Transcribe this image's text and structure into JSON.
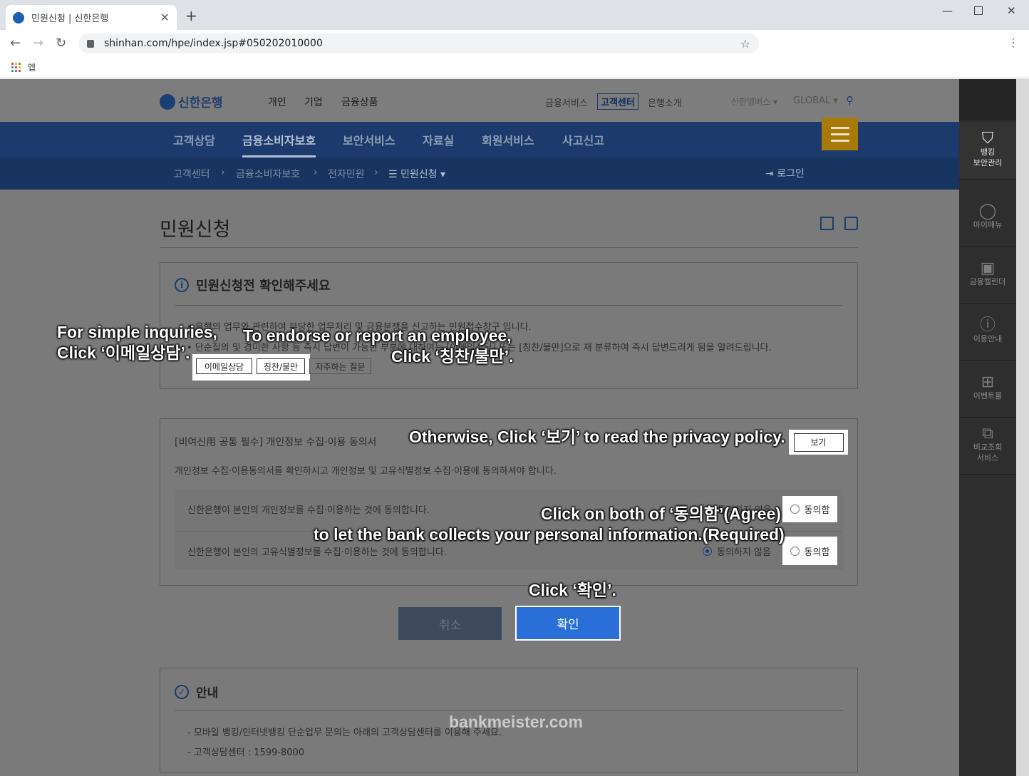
{
  "browser": {
    "tab_title": "민원신청 | 신한은행",
    "url": "shinhan.com/hpe/index.jsp#050202010000",
    "bookmark": "앱"
  },
  "header": {
    "logo": "신한은행",
    "nav": [
      "개인",
      "기업",
      "금융상품"
    ],
    "util": [
      "금융서비스",
      "고객센터",
      "은행소개"
    ],
    "sub": [
      "신한멤버스 ▾",
      "GLOBAL ▾"
    ]
  },
  "gnb": [
    "고객상담",
    "금융소비자보호",
    "보안서비스",
    "자료실",
    "회원서비스",
    "사고신고"
  ],
  "breadcrumb": [
    "고객센터",
    "금융소비자보호",
    "전자민원",
    "☰ 민원신청 ▾"
  ],
  "login": "로그인",
  "page_title": "민원신청",
  "notice": {
    "title": "민원신청전 확인해주세요",
    "line1": "• 은행의 업무와 관련하여 부당한 업무처리 및 금융분쟁을 신고하는 민원접수창구 입니다.",
    "line2": "• 단순질의 및 경미한 사항 등 즉시 답변이 가능한 부분에 대하여는 [이메일상담] 또는 [칭찬/불만]으로 재 분류하여 즉시 답변드리게 됨을 알려드립니다.",
    "btn_email": "이메일상담",
    "btn_praise": "칭찬/불만",
    "btn_faq": "자주하는 질문"
  },
  "consent": {
    "title": "[비여신用 공통 필수] 개인정보 수집·이용 동의서",
    "desc": "개인정보 수집·이용동의서를 확인하시고 개인정보 및 고유식별정보 수집·이용에 동의하셔야 합니다.",
    "view": "보기",
    "row1": "신한은행이 본인의 개인정보를 수집·이용하는 것에 동의합니다.",
    "row2": "신한은행이 본인의 고유식별정보를 수집·이용하는 것에 동의합니다.",
    "agree": "동의함",
    "disagree": "동의하지 않음"
  },
  "buttons": {
    "cancel": "취소",
    "ok": "확인"
  },
  "info": {
    "title": "안내",
    "line1": "- 모바일 뱅킹/인터넷뱅킹 단순업무 문의는 아래의 고객상담센터를 이용해 주세요.",
    "line2": "- 고객상담센터 : 1599-8000"
  },
  "quick": [
    {
      "icon": "shield-icon",
      "label": "뱅킹\n보안관리"
    },
    {
      "icon": "person-icon",
      "label": "마이메뉴"
    },
    {
      "icon": "calendar-icon",
      "label": "금융캘린더"
    },
    {
      "icon": "info-icon",
      "label": "이용안내"
    },
    {
      "icon": "gift-icon",
      "label": "이벤트몰"
    },
    {
      "icon": "compare-icon",
      "label": "비교조회\n서비스"
    }
  ],
  "annotations": {
    "a1l1": "For simple inquiries,",
    "a1l2": "Click ‘이메일상담’.",
    "a2l1": "To endorse or report an employee,",
    "a2l2": "Click ‘칭찬/불만’.",
    "a3": "Otherwise, Click ‘보기’ to read the privacy policy.",
    "a4l1": "Click on both of ‘동의함’(Agree)",
    "a4l2": "to let the bank collects your personal information.(Required)",
    "a5": "Click ‘확인’."
  },
  "watermark": "bankmeister.com"
}
